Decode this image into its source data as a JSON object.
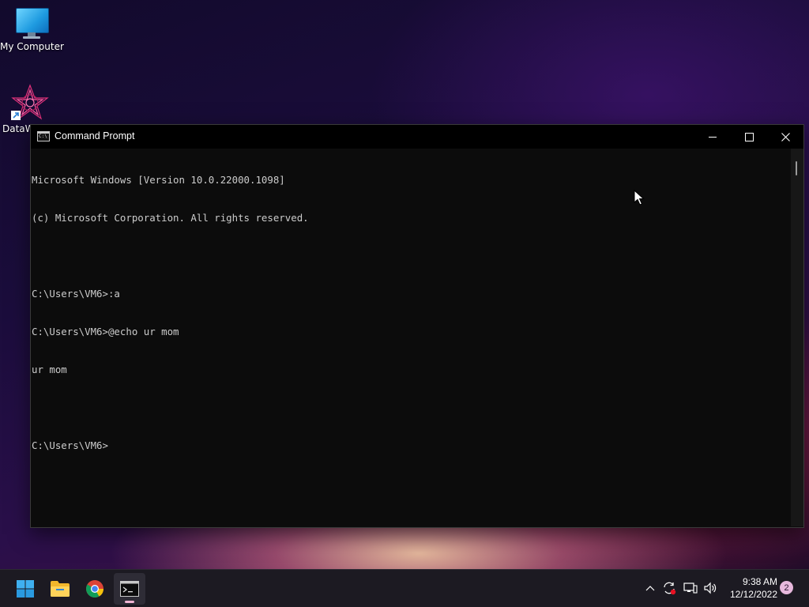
{
  "desktop": {
    "icons": [
      {
        "label": "My Computer",
        "icon": "computer-icon"
      },
      {
        "label": "DataW",
        "icon": "datawrapper-icon"
      }
    ]
  },
  "window": {
    "title": "Command Prompt",
    "icon": "cmd-icon",
    "app_icon_text": "C:\\",
    "controls": [
      "minimize-icon",
      "maximize-icon",
      "close-icon"
    ]
  },
  "console": {
    "lines": [
      "Microsoft Windows [Version 10.0.22000.1098]",
      "(c) Microsoft Corporation. All rights reserved.",
      "",
      "C:\\Users\\VM6>:a",
      "C:\\Users\\VM6>@echo ur mom",
      "ur mom",
      "",
      "C:\\Users\\VM6>"
    ],
    "text_color": "#cccccc",
    "background": "#0c0c0c"
  },
  "taskbar": {
    "apps": [
      {
        "name": "Start",
        "icon": "windows-start-icon"
      },
      {
        "name": "File Explorer",
        "icon": "folder-icon"
      },
      {
        "name": "Google Chrome",
        "icon": "chrome-icon"
      },
      {
        "name": "Command Prompt",
        "icon": "cmd-icon",
        "active": true
      }
    ],
    "tray": {
      "icons": [
        "chevron-up-icon",
        "sync-icon",
        "network-icon",
        "volume-icon"
      ],
      "time": "9:38 AM",
      "date": "12/12/2022",
      "notification_count": "2"
    }
  }
}
